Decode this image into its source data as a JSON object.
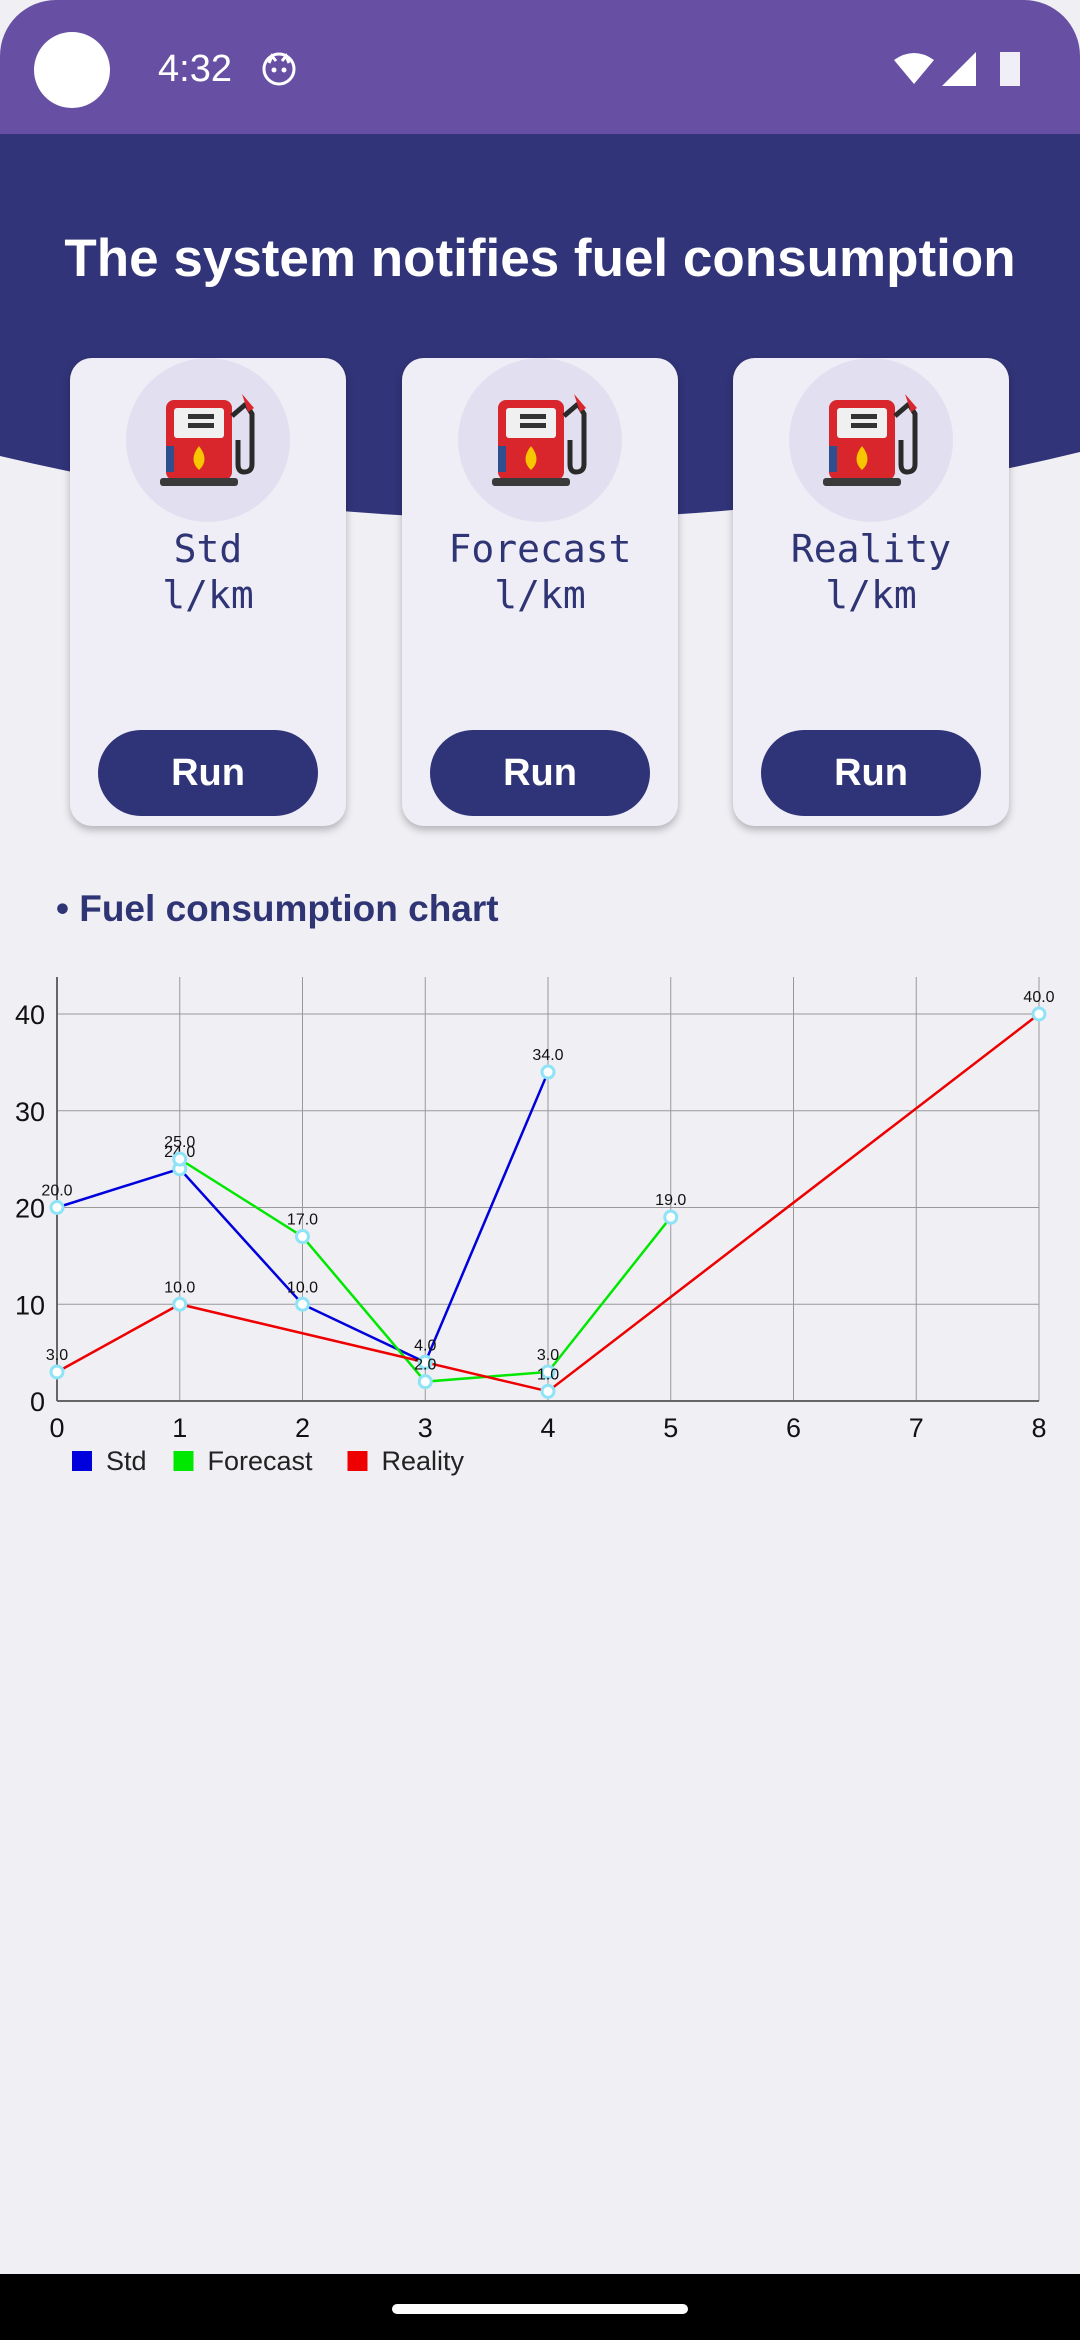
{
  "status_bar": {
    "time": "4:32"
  },
  "header": {
    "title": "The system notifies fuel consumption"
  },
  "cards": [
    {
      "label": "Std\nl/km",
      "button": "Run"
    },
    {
      "label": "Forecast\nl/km",
      "button": "Run"
    },
    {
      "label": "Reality\nl/km",
      "button": "Run"
    }
  ],
  "section": {
    "title": "• Fuel consumption chart"
  },
  "colors": {
    "status_bar": "#6750a4",
    "header": "#313478",
    "std": "#0000dd",
    "forecast": "#00e800",
    "reality": "#ee0000",
    "point": "#8fe3f7"
  },
  "chart_data": {
    "type": "line",
    "xlim": [
      0,
      8
    ],
    "ylim": [
      0,
      40
    ],
    "x_ticks": [
      0,
      1,
      2,
      3,
      4,
      5,
      6,
      7,
      8
    ],
    "y_ticks": [
      0,
      10,
      20,
      30,
      40
    ],
    "grid": true,
    "legend": "bottom-left",
    "series": [
      {
        "name": "Std",
        "color": "#0000dd",
        "x": [
          0,
          1,
          2,
          3,
          4
        ],
        "y": [
          20.0,
          24.0,
          10.0,
          4.0,
          34.0
        ],
        "labels": [
          "20.0",
          "24.0",
          "10.0",
          "4.0",
          "34.0"
        ]
      },
      {
        "name": "Forecast",
        "color": "#00e800",
        "x": [
          1,
          2,
          3,
          4,
          5
        ],
        "y": [
          25.0,
          17.0,
          2.0,
          3.0,
          19.0
        ],
        "labels": [
          "25.0",
          "17.0",
          "2.0",
          "3.0",
          "19.0"
        ]
      },
      {
        "name": "Reality",
        "color": "#ee0000",
        "x": [
          0,
          1,
          4,
          8
        ],
        "y": [
          3.0,
          10.0,
          1.0,
          40.0
        ],
        "labels": [
          "3.0",
          "10.0",
          "1.0",
          "40.0"
        ]
      }
    ]
  }
}
